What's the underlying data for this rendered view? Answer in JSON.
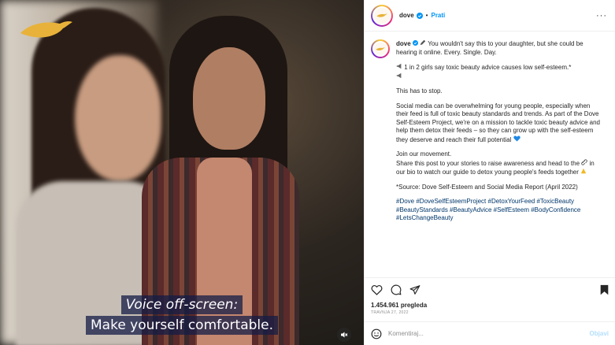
{
  "video": {
    "subtitle_line1": "Voice off-screen:",
    "subtitle_line2": "Make yourself comfortable.",
    "logo_icon": "dove-bird-logo",
    "mute_icon": "speaker-muted-icon"
  },
  "header": {
    "username": "dove",
    "separator": "•",
    "follow_label": "Prati",
    "more_label": "···"
  },
  "caption": {
    "username": "dove",
    "intro": "You wouldn't say this to your daughter, but she could be hearing it online. Every. Single. Day.",
    "stat": "1 in 2 girls say toxic beauty advice causes low self-esteem.*",
    "stop": "This has to stop.",
    "body": "Social media can be overwhelming for young people, especially when their feed is full of toxic beauty standards and trends. As part of the Dove Self-Esteem Project, we're on a mission to tackle toxic beauty advice and help them detox their feeds – so they can grow up with the self-esteem they deserve and reach their full potential",
    "join": "Join our movement.",
    "share": "Share this post to your stories to raise awareness and head to the",
    "share_cont": "in our bio to watch our guide to detox young people's feeds together",
    "source": "*Source: Dove Self-Esteem and Social Media Report (April 2022)",
    "hashtags": "#Dove #DoveSelfEsteemProject #DetoxYourFeed #ToxicBeauty #BeautyStandards #BeautyAdvice #SelfEsteem #BodyConfidence #LetsChangeBeauty"
  },
  "stats": {
    "views": "1.454.961 pregleda",
    "date": "TRAVNJA 27, 2022"
  },
  "comment": {
    "placeholder": "Komentiraj...",
    "post_label": "Objavi"
  },
  "colors": {
    "accent": "#0095f6",
    "link": "#00376b",
    "muted": "#8e8e8e",
    "subtitle_bg": "#141c46",
    "logo": "#e8b23a"
  }
}
